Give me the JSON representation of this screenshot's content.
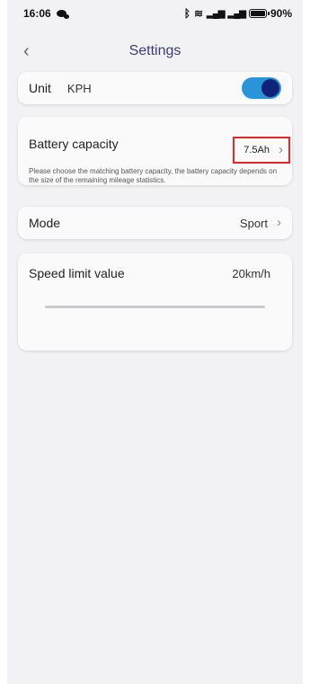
{
  "status_bar": {
    "time": "16:06",
    "battery_text": "90%",
    "battery_level": 0.9,
    "icons": [
      "chat-bubble-icon",
      "bluetooth-icon",
      "wifi-icon",
      "signal-icon",
      "signal-icon",
      "battery-icon"
    ]
  },
  "header": {
    "back_icon": "‹",
    "title": "Settings"
  },
  "unit": {
    "label": "Unit",
    "value": "KPH",
    "toggle_on": true,
    "toggle_color": "#2b94d8",
    "knob_color": "#10237a"
  },
  "battery_capacity": {
    "label": "Battery capacity",
    "value": "7.5Ah",
    "chevron": "›",
    "note": "Please choose the matching battery capacity, the battery capacity depends on the size of the remaining mileage statistics.",
    "highlight_color": "#e02a2a"
  },
  "mode": {
    "label": "Mode",
    "value": "Sport",
    "chevron": "›"
  },
  "speed_limit": {
    "label": "Speed limit value",
    "value": "20km/h"
  }
}
